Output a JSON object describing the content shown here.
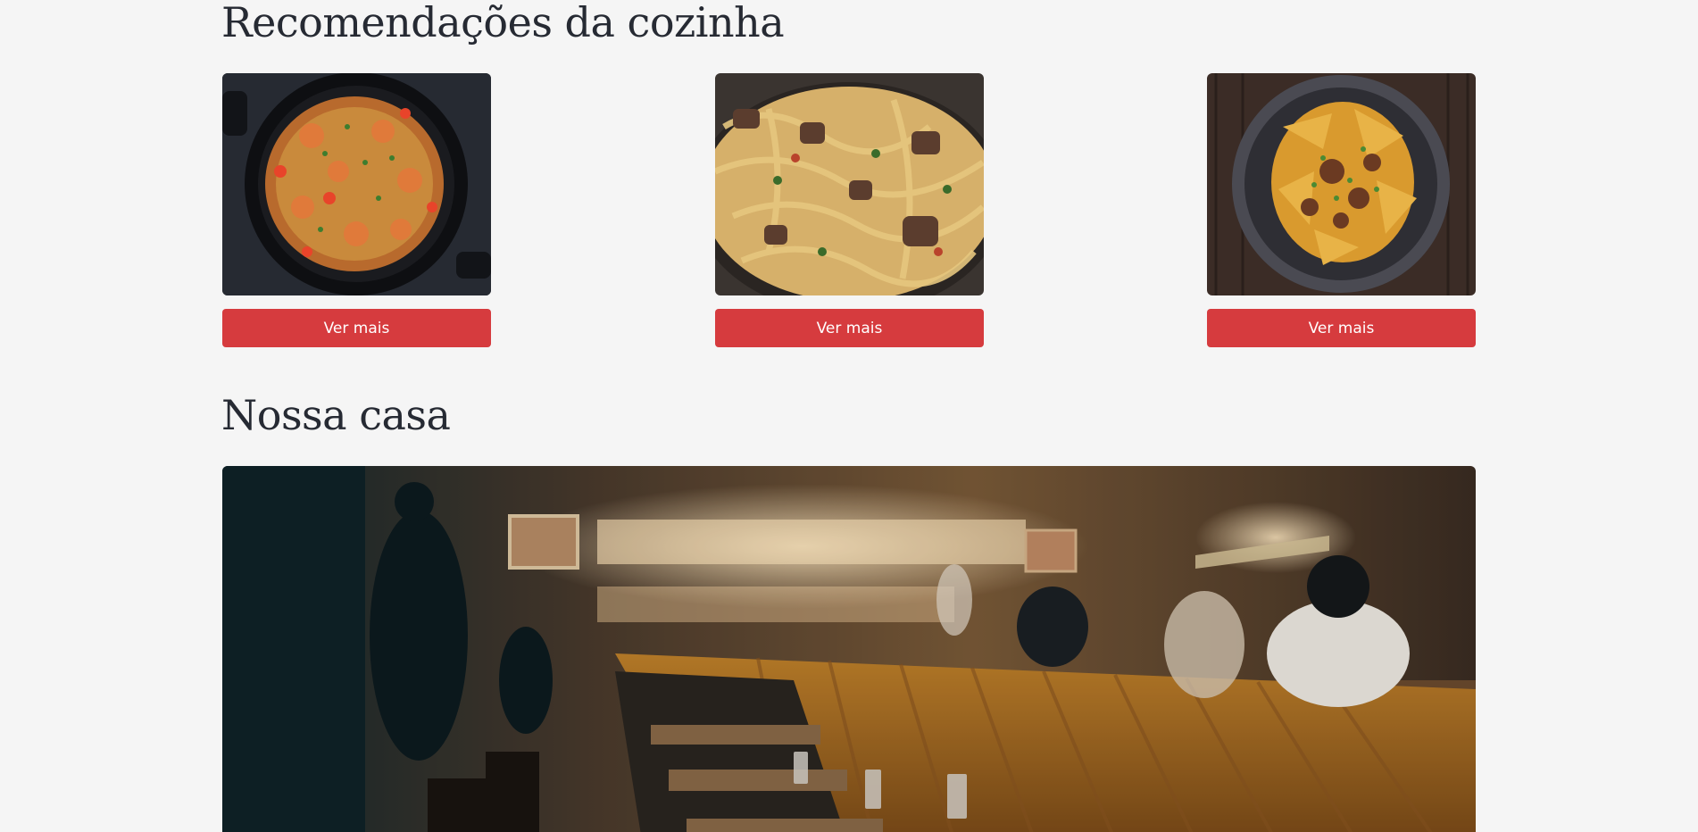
{
  "recommendations": {
    "title": "Recomendações da cozinha",
    "cards": [
      {
        "image": "shrimp-spaghetti-pan-image",
        "button_label": "Ver mais"
      },
      {
        "image": "beef-fettuccine-skillet-image",
        "button_label": "Ver mais"
      },
      {
        "image": "pappardelle-ragu-bowl-image",
        "button_label": "Ver mais"
      }
    ]
  },
  "house": {
    "title": "Nossa casa",
    "image": "restaurant-interior-image"
  },
  "colors": {
    "background": "#f5f5f5",
    "heading": "#262a33",
    "button": "#d63b3e",
    "button_text": "#ffffff"
  }
}
